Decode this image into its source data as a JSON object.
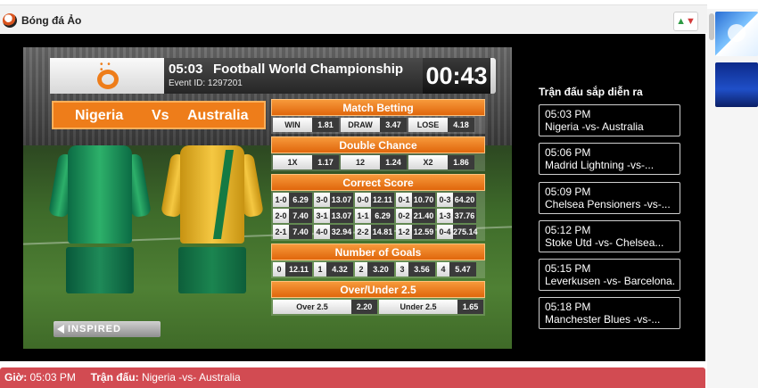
{
  "header": {
    "title": "Bóng đá Ảo",
    "sort_up": "▲",
    "sort_down": "▼"
  },
  "video": {
    "time": "05:03",
    "title": "Football World Championship",
    "event_id": "Event ID: 1297201",
    "countdown": "00:43",
    "home": "Nigeria",
    "vs": "Vs",
    "away": "Australia",
    "brand": "INSPIRED"
  },
  "markets": {
    "match_betting": {
      "title": "Match Betting",
      "items": [
        [
          "WIN",
          "1.81"
        ],
        [
          "DRAW",
          "3.47"
        ],
        [
          "LOSE",
          "4.18"
        ]
      ]
    },
    "double_chance": {
      "title": "Double Chance",
      "items": [
        [
          "1X",
          "1.17"
        ],
        [
          "12",
          "1.24"
        ],
        [
          "X2",
          "1.86"
        ]
      ]
    },
    "correct_score": {
      "title": "Correct Score",
      "rows": [
        [
          [
            "1-0",
            "6.29"
          ],
          [
            "3-0",
            "13.07"
          ],
          [
            "0-0",
            "12.11"
          ],
          [
            "0-1",
            "10.70"
          ],
          [
            "0-3",
            "64.20"
          ]
        ],
        [
          [
            "2-0",
            "7.40"
          ],
          [
            "3-1",
            "13.07"
          ],
          [
            "1-1",
            "6.29"
          ],
          [
            "0-2",
            "21.40"
          ],
          [
            "1-3",
            "37.76"
          ]
        ],
        [
          [
            "2-1",
            "7.40"
          ],
          [
            "4-0",
            "32.94"
          ],
          [
            "2-2",
            "14.81"
          ],
          [
            "1-2",
            "12.59"
          ],
          [
            "0-4",
            "275.14"
          ]
        ]
      ]
    },
    "number_of_goals": {
      "title": "Number of Goals",
      "items": [
        [
          "0",
          "12.11"
        ],
        [
          "1",
          "4.32"
        ],
        [
          "2",
          "3.20"
        ],
        [
          "3",
          "3.56"
        ],
        [
          "4",
          "5.47"
        ]
      ]
    },
    "over_under": {
      "title": "Over/Under 2.5",
      "items": [
        [
          "Over 2.5",
          "2.20"
        ],
        [
          "Under 2.5",
          "1.65"
        ]
      ]
    }
  },
  "upcoming": {
    "title": "Trận đấu sắp diễn ra",
    "matches": [
      {
        "time": "05:03 PM",
        "name": "Nigeria -vs- Australia"
      },
      {
        "time": "05:06 PM",
        "name": "Madrid Lightning -vs-..."
      },
      {
        "time": "05:09 PM",
        "name": "Chelsea Pensioners -vs-..."
      },
      {
        "time": "05:12 PM",
        "name": "Stoke Utd -vs- Chelsea..."
      },
      {
        "time": "05:15 PM",
        "name": "Leverkusen -vs- Barcelona..."
      },
      {
        "time": "05:18 PM",
        "name": "Manchester Blues -vs-..."
      }
    ]
  },
  "status": {
    "time_label": "Giờ:",
    "time_value": "05:03 PM",
    "match_label": "Trận đấu:",
    "match_value": "Nigeria -vs- Australia"
  },
  "colors": {
    "accent": "#ee7d1a",
    "status_bar": "#d24b52",
    "stage": "#000000"
  }
}
